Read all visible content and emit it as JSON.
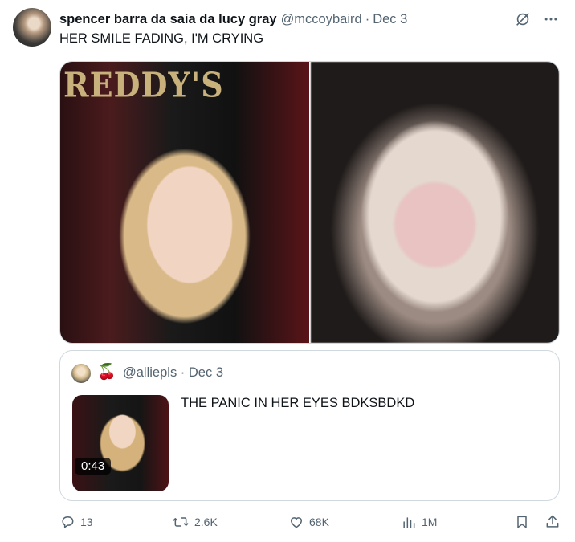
{
  "tweet": {
    "display_name": "spencer barra da saia da lucy gray",
    "handle": "@mccoybaird",
    "separator": "·",
    "date": "Dec 3",
    "text": "HER SMILE FADING, I'M CRYING",
    "media": {
      "left_sign_text": "REDDY'S"
    }
  },
  "quote": {
    "emoji": "🍒",
    "handle": "@alliepls",
    "separator": "·",
    "date": "Dec 3",
    "text": "THE PANIC IN HER EYES BDKSBDKD",
    "video_duration": "0:43"
  },
  "actions": {
    "replies": "13",
    "reposts": "2.6K",
    "likes": "68K",
    "views": "1M"
  },
  "icons": {
    "grok": "grok-icon",
    "more": "more-icon",
    "reply": "reply-icon",
    "repost": "repost-icon",
    "like": "like-icon",
    "views": "views-icon",
    "bookmark": "bookmark-icon",
    "share": "share-icon"
  },
  "colors": {
    "text": "#0f1419",
    "secondary": "#536471",
    "border": "#cfd9de"
  }
}
